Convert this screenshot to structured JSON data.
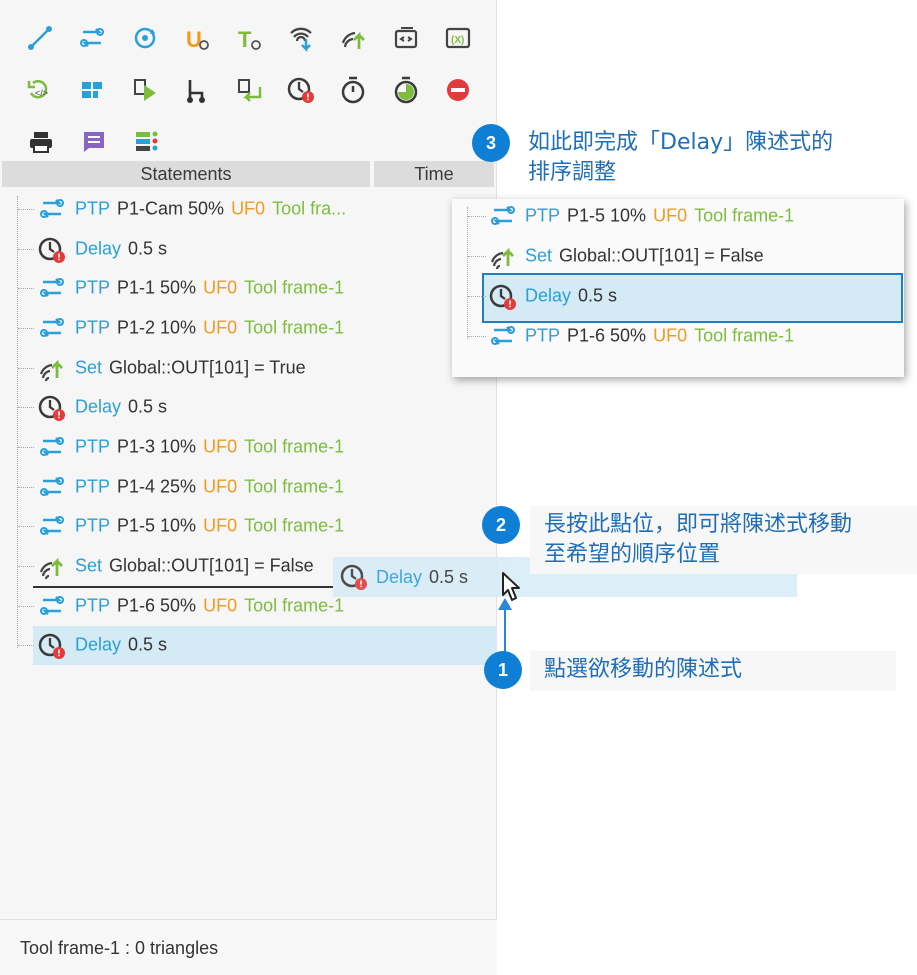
{
  "toolbar": {
    "rows": [
      [
        "line-icon",
        "ptp-move-icon",
        "circle-move-icon",
        "user-frame-icon",
        "tool-frame-icon",
        "input-signal-icon",
        "output-signal-icon",
        "subprogram-icon",
        "variable-icon"
      ],
      [
        "script-icon",
        "pallet-icon",
        "run-icon",
        "branch-icon",
        "return-icon",
        "delay-icon",
        "timer-icon",
        "timer-start-icon",
        "stop-icon"
      ],
      [
        "print-icon",
        "message-icon",
        "list-icon"
      ]
    ]
  },
  "header": {
    "statements": "Statements",
    "time": "Time"
  },
  "statements": [
    {
      "type": "ptp",
      "kw": "PTP",
      "val": "P1-Cam 50%",
      "uf": "UF0",
      "tf": "Tool fra..."
    },
    {
      "type": "delay",
      "kw": "Delay",
      "val": "0.5 s"
    },
    {
      "type": "ptp",
      "kw": "PTP",
      "val": "P1-1 50%",
      "uf": "UF0",
      "tf": "Tool frame-1"
    },
    {
      "type": "ptp",
      "kw": "PTP",
      "val": "P1-2 10%",
      "uf": "UF0",
      "tf": "Tool frame-1"
    },
    {
      "type": "set",
      "kw": "Set",
      "val": "Global::OUT[101] = True"
    },
    {
      "type": "delay",
      "kw": "Delay",
      "val": "0.5 s"
    },
    {
      "type": "ptp",
      "kw": "PTP",
      "val": "P1-3 10%",
      "uf": "UF0",
      "tf": "Tool frame-1"
    },
    {
      "type": "ptp",
      "kw": "PTP",
      "val": "P1-4 25%",
      "uf": "UF0",
      "tf": "Tool frame-1"
    },
    {
      "type": "ptp",
      "kw": "PTP",
      "val": "P1-5 10%",
      "uf": "UF0",
      "tf": "Tool frame-1"
    },
    {
      "type": "set",
      "kw": "Set",
      "val": "Global::OUT[101] = False"
    },
    {
      "type": "ptp",
      "kw": "PTP",
      "val": "P1-6 50%",
      "uf": "UF0",
      "tf": "Tool frame-1"
    },
    {
      "type": "delay",
      "kw": "Delay",
      "val": "0.5 s",
      "selected": true
    }
  ],
  "drag_ghost": {
    "kw": "Delay",
    "val": "0.5 s"
  },
  "status": "Tool frame-1 : 0 triangles",
  "callouts": {
    "c1": {
      "num": "1",
      "text": "點選欲移動的陳述式"
    },
    "c2": {
      "num": "2",
      "line1": "長按此點位，即可將陳述式移動",
      "line2": "至希望的順序位置"
    },
    "c3": {
      "num": "3",
      "line1": "如此即完成「Delay」陳述式的",
      "line2": "排序調整"
    }
  },
  "inset": [
    {
      "type": "ptp",
      "kw": "PTP",
      "val": "P1-5 10%",
      "uf": "UF0",
      "tf": "Tool frame-1"
    },
    {
      "type": "set",
      "kw": "Set",
      "val": "Global::OUT[101] = False"
    },
    {
      "type": "delay",
      "kw": "Delay",
      "val": "0.5 s",
      "highlighted": true
    },
    {
      "type": "ptp",
      "kw": "PTP",
      "val": "P1-6 50%",
      "uf": "UF0",
      "tf": "Tool frame-1"
    }
  ],
  "colors": {
    "keyword": "#2b9fd9",
    "user_frame": "#f39a1e",
    "tool_frame": "#7cbd3e",
    "selection": "#d4eaf5",
    "callout_badge": "#0f7fd6"
  }
}
